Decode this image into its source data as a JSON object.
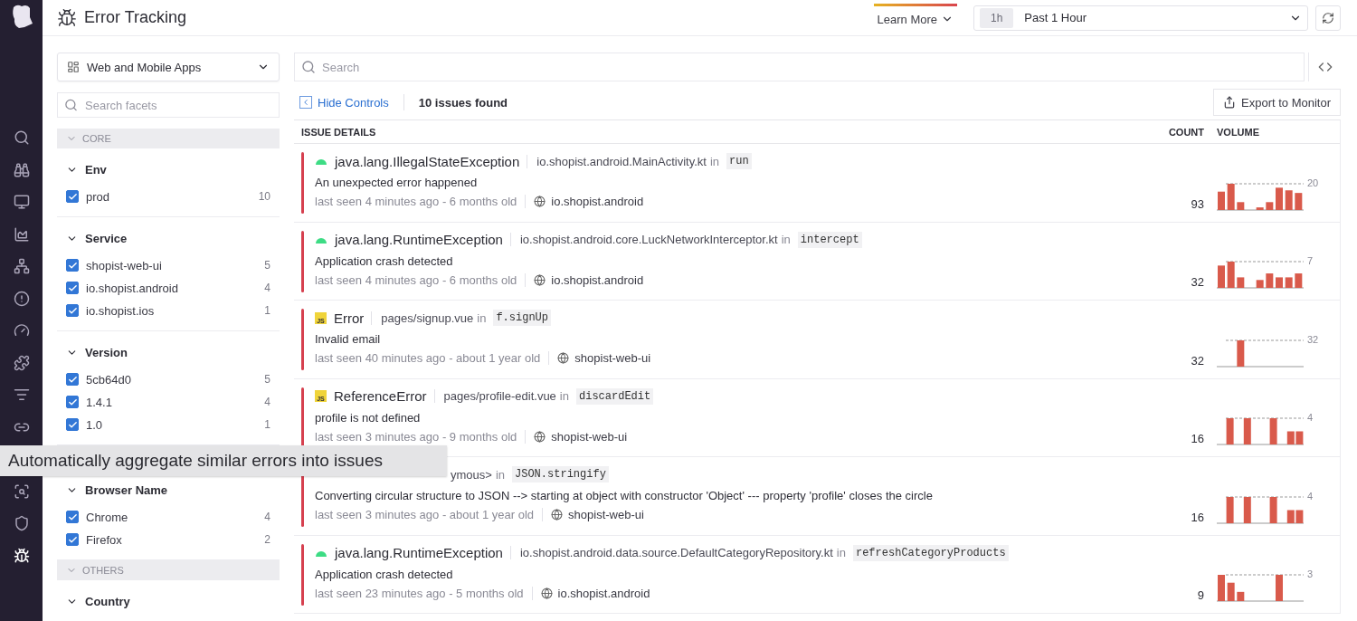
{
  "nav": [
    {
      "kind": "search",
      "selected": false
    },
    {
      "kind": "binoculars",
      "selected": false
    },
    {
      "kind": "monitor",
      "selected": false
    },
    {
      "kind": "chart",
      "selected": false
    },
    {
      "kind": "network",
      "selected": false
    },
    {
      "kind": "alert",
      "selected": false
    },
    {
      "kind": "gauge",
      "selected": false
    },
    {
      "kind": "puzzle",
      "selected": false
    },
    {
      "kind": "filter",
      "selected": false
    },
    {
      "kind": "link",
      "selected": false
    },
    {
      "kind": "scan",
      "selected": false
    },
    {
      "kind": "shield",
      "selected": false
    },
    {
      "kind": "bug",
      "selected": true
    }
  ],
  "header": {
    "title": "Error Tracking",
    "learn_more": "Learn More",
    "time_chip": "1h",
    "time_range": "Past 1 Hour"
  },
  "scope_select": "Web and Mobile Apps",
  "search": {
    "placeholder": "Search"
  },
  "facet_search": {
    "placeholder": "Search facets"
  },
  "facet_sections": [
    {
      "label": "CORE",
      "groups": [
        {
          "title": "Env",
          "items": [
            {
              "label": "prod",
              "count": "10",
              "checked": true
            }
          ]
        },
        {
          "title": "Service",
          "items": [
            {
              "label": "shopist-web-ui",
              "count": "5",
              "checked": true
            },
            {
              "label": "io.shopist.android",
              "count": "4",
              "checked": true
            },
            {
              "label": "io.shopist.ios",
              "count": "1",
              "checked": true
            }
          ]
        },
        {
          "title": "Version",
          "items": [
            {
              "label": "5cb64d0",
              "count": "5",
              "checked": true
            },
            {
              "label": "1.4.1",
              "count": "4",
              "checked": true
            },
            {
              "label": "1.0",
              "count": "1",
              "checked": true
            }
          ]
        },
        {
          "title": "Browser Name",
          "items": [
            {
              "label": "Chrome",
              "count": "4",
              "checked": true
            },
            {
              "label": "Firefox",
              "count": "2",
              "checked": true
            }
          ]
        }
      ]
    },
    {
      "label": "OTHERS",
      "groups": [
        {
          "title": "Country"
        }
      ]
    }
  ],
  "controls": {
    "hide_controls": "Hide Controls",
    "issues_found": "10 issues found",
    "export": "Export to Monitor"
  },
  "table": {
    "columns": [
      "ISSUE DETAILS",
      "COUNT",
      "VOLUME"
    ],
    "issues": [
      {
        "kind": "android",
        "type": "java.lang.IllegalStateException",
        "location": "io.shopist.android.MainActivity.kt",
        "in": "in",
        "function": "run",
        "message": "An unexpected error happened",
        "seen": "last seen 4 minutes ago - 6 months old",
        "service": "io.shopist.android",
        "count": "93",
        "volume_max": "20"
      },
      {
        "kind": "android",
        "type": "java.lang.RuntimeException",
        "location": "io.shopist.android.core.LuckNetworkInterceptor.kt",
        "in": "in",
        "function": "intercept",
        "message": "Application crash detected",
        "seen": "last seen 4 minutes ago - 6 months old",
        "service": "io.shopist.android",
        "count": "32",
        "volume_max": "7"
      },
      {
        "kind": "js",
        "badge": "JS",
        "type": "Error",
        "location": "pages/signup.vue",
        "in": "in",
        "function": "f.signUp",
        "message": "Invalid email",
        "seen": "last seen 40 minutes ago - about 1 year old",
        "service": "shopist-web-ui",
        "count": "32",
        "volume_max": "32"
      },
      {
        "kind": "js",
        "badge": "JS",
        "type": "ReferenceError",
        "location": "pages/profile-edit.vue",
        "in": "in",
        "function": "discardEdit",
        "message": "profile is not defined",
        "seen": "last seen 3 minutes ago - 9 months old",
        "service": "shopist-web-ui",
        "count": "16",
        "volume_max": "4"
      },
      {
        "location": "ymous>",
        "in": "in",
        "function": "JSON.stringify",
        "message": "Converting circular structure to JSON --> starting at object with constructor 'Object' --- property 'profile' closes the circle",
        "seen": "last seen 3 minutes ago - about 1 year old",
        "service": "shopist-web-ui",
        "count": "16",
        "volume_max": "4"
      },
      {
        "kind": "android",
        "type": "java.lang.RuntimeException",
        "location": "io.shopist.android.data.source.DefaultCategoryRepository.kt",
        "in": "in",
        "function": "refreshCategoryProducts",
        "message": "Application crash detected",
        "seen": "last seen 23 minutes ago - 5 months old",
        "service": "io.shopist.android",
        "count": "9",
        "volume_max": "3"
      }
    ]
  },
  "tooltip": "Automatically aggregate similar errors into issues"
}
